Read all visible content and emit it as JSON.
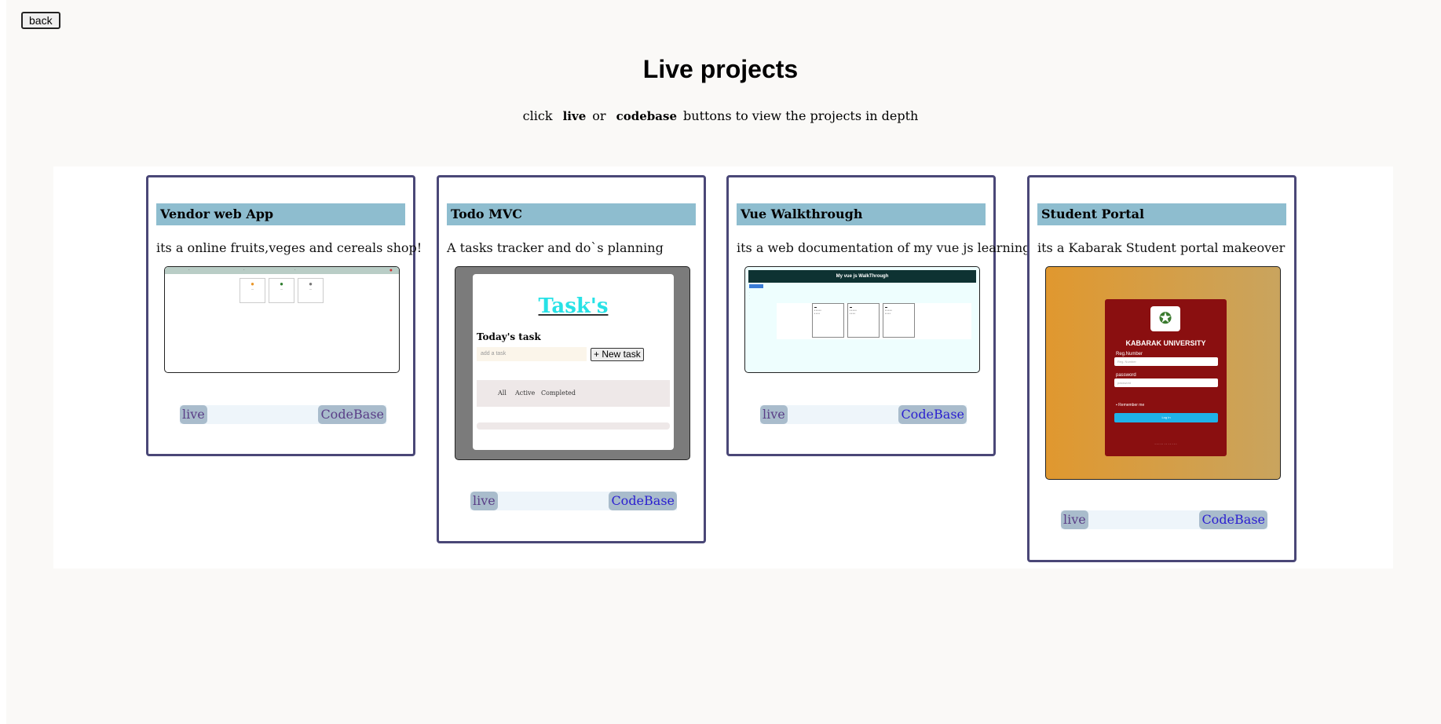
{
  "header": {
    "back_label": "back",
    "title": "Live projects",
    "subtitle_pre": "click",
    "subtitle_live": "live",
    "subtitle_or": "or",
    "subtitle_codebase": "codebase",
    "subtitle_post": "buttons to view the projects in depth"
  },
  "projects": [
    {
      "title": "Vendor web App",
      "description": "its a online fruits,veges and cereals shop!",
      "live_label": "live",
      "code_label": "CodeBase"
    },
    {
      "title": "Todo MVC",
      "description": "A tasks tracker and do`s planning",
      "live_label": "live",
      "code_label": "CodeBase",
      "preview": {
        "heading": "Task's",
        "today": "Today's task",
        "placeholder": "add a task",
        "new_task": "+ New task",
        "filters": [
          "All",
          "Active",
          "Completed"
        ]
      }
    },
    {
      "title": "Vue Walkthrough",
      "description": "its a web documentation of my vue js learning curve",
      "live_label": "live",
      "code_label": "CodeBase",
      "preview": {
        "heading": "My vue js WalkThrough"
      }
    },
    {
      "title": "Student Portal",
      "description": "its a Kabarak Student portal makeover",
      "live_label": "live",
      "code_label": "CodeBase",
      "preview": {
        "university": "KABARAK UNIVERSITY",
        "reg_label": "Reg.Number",
        "reg_placeholder": "Reg. Number",
        "password_label": "password",
        "password_placeholder": "password",
        "remember": "Remember me",
        "login": "Log In"
      }
    }
  ],
  "colors": {
    "card_border": "#4a4777",
    "title_bar": "#8ebdcf",
    "button_bg": "#a9bccc",
    "codebase_text": "#2b1fd0",
    "visited_text": "#5a3e87"
  }
}
